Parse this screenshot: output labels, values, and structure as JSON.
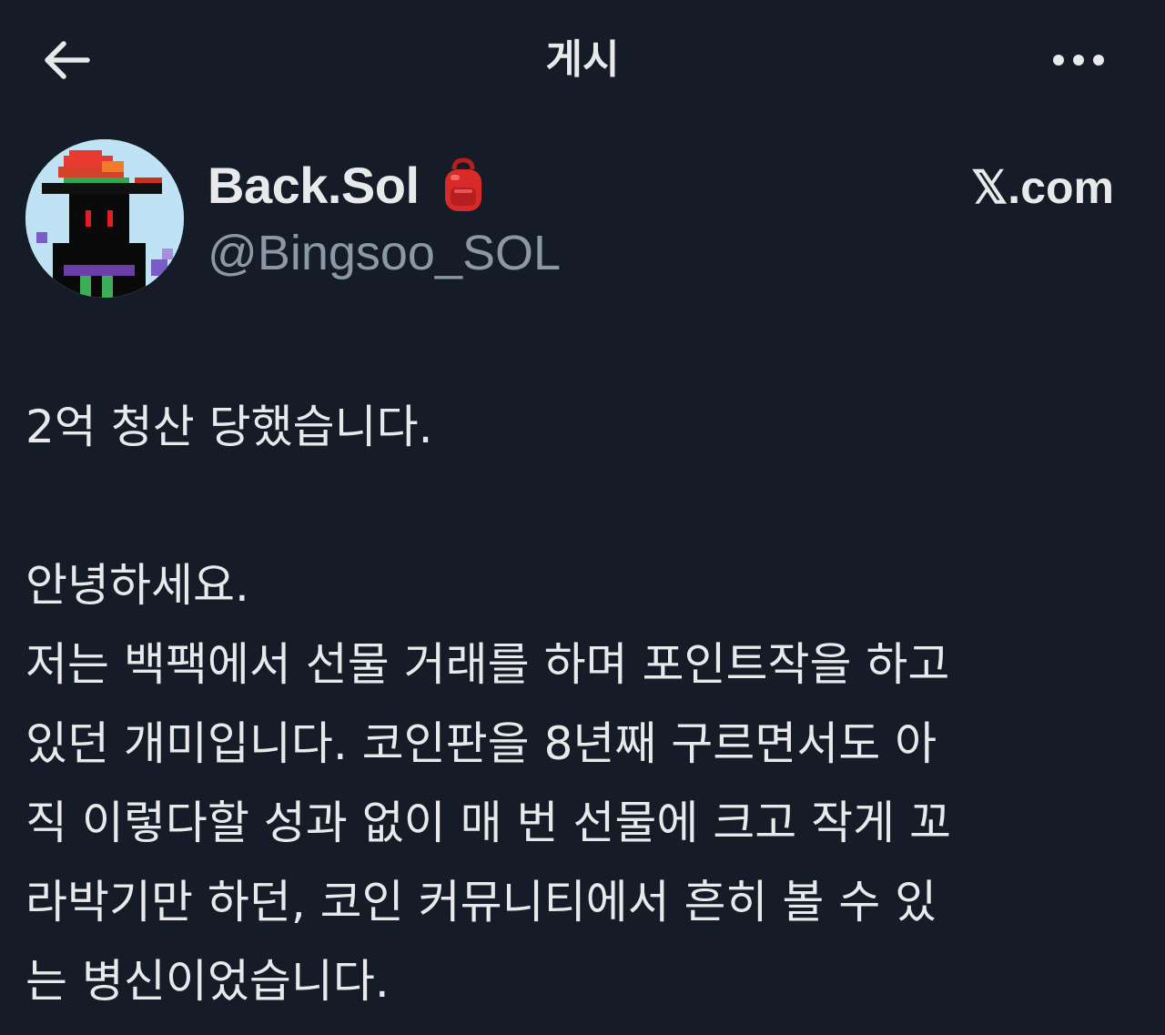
{
  "header": {
    "title": "게시"
  },
  "author": {
    "display_name": "Back.Sol",
    "handle": "@Bingsoo_SOL",
    "source_label": "𝕏.com"
  },
  "post": {
    "headline": "2억 청산 당했습니다.",
    "lines": [
      "안녕하세요.",
      "저는 백팩에서 선물 거래를 하며 포인트작을 하고",
      "있던 개미입니다. 코인판을 8년째 구르면서도 아",
      "직 이렇다할 성과 없이 매 번 선물에 크고 작게 꼬",
      "라박기만 하던, 코인 커뮤니티에서 흔히 볼 수 있",
      "는 병신이었습니다."
    ]
  },
  "icons": {
    "back": "arrow-left-icon",
    "more": "more-dots-icon",
    "badge": "backpack-icon"
  },
  "colors": {
    "background": "#161c27",
    "text": "#e7e9ea",
    "muted": "#8b98a5"
  }
}
